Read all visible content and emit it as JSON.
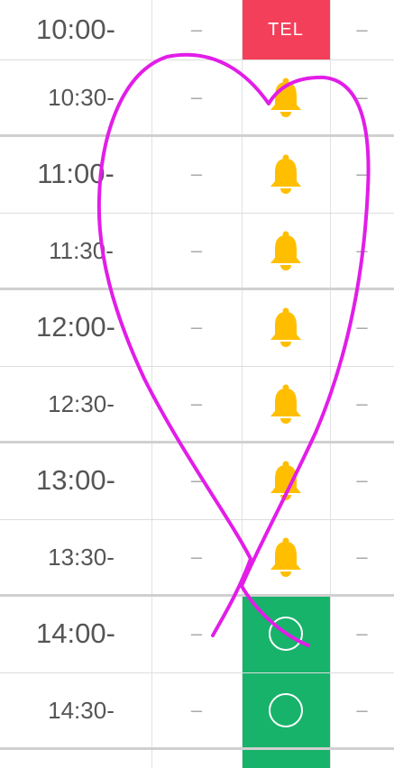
{
  "schedule": {
    "rows": [
      {
        "time": "10:00-",
        "kind": "hour",
        "col1": "–",
        "col2_type": "tel",
        "col2_text": "TEL",
        "col3": "–"
      },
      {
        "time": "10:30-",
        "kind": "half",
        "col1": "–",
        "col2_type": "bell",
        "col3": "–"
      },
      {
        "time": "11:00-",
        "kind": "hour",
        "col1": "–",
        "col2_type": "bell",
        "col3": "–"
      },
      {
        "time": "11:30-",
        "kind": "half",
        "col1": "–",
        "col2_type": "bell",
        "col3": "–"
      },
      {
        "time": "12:00-",
        "kind": "hour",
        "col1": "–",
        "col2_type": "bell",
        "col3": "–"
      },
      {
        "time": "12:30-",
        "kind": "half",
        "col1": "–",
        "col2_type": "bell",
        "col3": "–"
      },
      {
        "time": "13:00-",
        "kind": "hour",
        "col1": "–",
        "col2_type": "bell",
        "col3": "–"
      },
      {
        "time": "13:30-",
        "kind": "half",
        "col1": "–",
        "col2_type": "bell",
        "col3": "–"
      },
      {
        "time": "14:00-",
        "kind": "hour",
        "col1": "–",
        "col2_type": "circle",
        "col3": "–"
      },
      {
        "time": "14:30-",
        "kind": "half",
        "col1": "–",
        "col2_type": "circle",
        "col3": "–"
      }
    ]
  },
  "colors": {
    "tel": "#f43f5a",
    "available": "#17b36a",
    "bell": "#ffbf00",
    "drawing": "#e21de8"
  },
  "icons": {
    "bell": "bell-icon",
    "circle": "circle-icon"
  }
}
